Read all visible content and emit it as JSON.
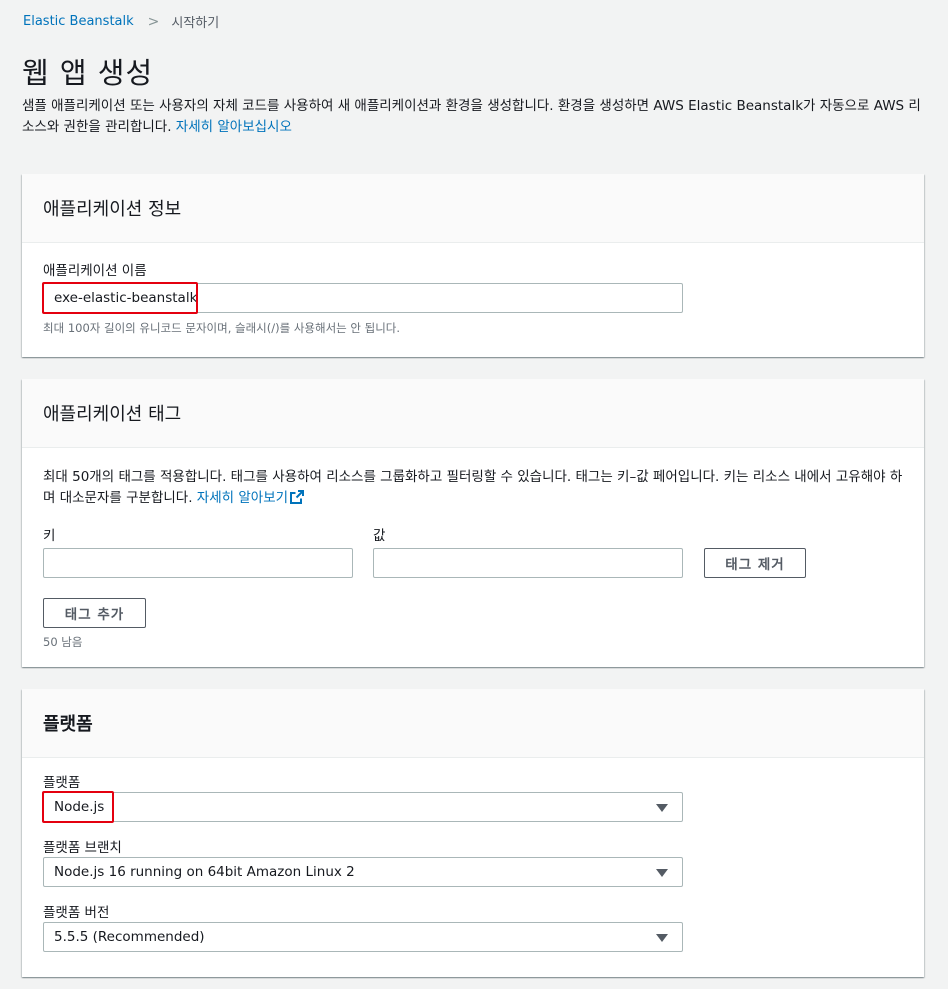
{
  "breadcrumb": {
    "root": "Elastic Beanstalk",
    "separator": ">",
    "current": "시작하기"
  },
  "page": {
    "title": "웹 앱 생성",
    "description": "샘플 애플리케이션 또는 사용자의 자체 코드를 사용하여 새 애플리케이션과 환경을 생성합니다. 환경을 생성하면 AWS Elastic Beanstalk가 자동으로 AWS 리소스와 권한을 관리합니다.",
    "learn_more": "자세히 알아보십시오"
  },
  "app_info": {
    "header": "애플리케이션 정보",
    "name_label": "애플리케이션 이름",
    "name_value": "exe-elastic-beanstalk",
    "name_hint": "최대 100자 길이의 유니코드 문자이며, 슬래시(/)를 사용해서는 안 됩니다."
  },
  "app_tags": {
    "header": "애플리케이션 태그",
    "description": "최대 50개의 태그를 적용합니다. 태그를 사용하여 리소스를 그룹화하고 필터링할 수 있습니다. 태그는 키–값 페어입니다. 키는 리소스 내에서 고유해야 하며 대소문자를 구분합니다.",
    "learn_more": "자세히 알아보기",
    "key_label": "키",
    "value_label": "값",
    "key_value": "",
    "value_value": "",
    "remove_button": "태그 제거",
    "add_button": "태그 추가",
    "remaining": "50 남음"
  },
  "platform": {
    "header": "플랫폼",
    "platform_label": "플랫폼",
    "platform_value": "Node.js",
    "branch_label": "플랫폼 브랜치",
    "branch_value": "Node.js 16 running on 64bit Amazon Linux 2",
    "version_label": "플랫폼 버전",
    "version_value": "5.5.5 (Recommended)"
  },
  "colors": {
    "link": "#0073bb",
    "highlight": "#e4000f",
    "background": "#f2f3f3"
  },
  "icons": {
    "breadcrumb_separator": "chevron-right-icon",
    "external_link": "external-link-icon",
    "dropdown": "caret-down-icon"
  }
}
